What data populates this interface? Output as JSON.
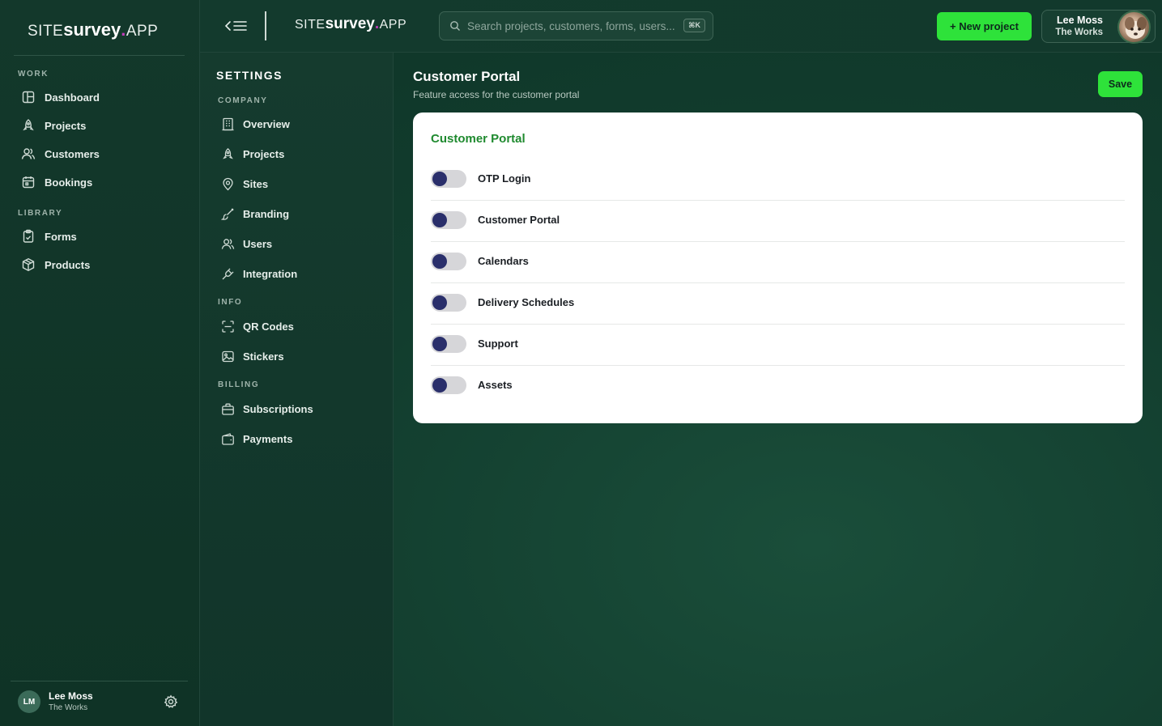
{
  "brand": {
    "prefix": "SITE",
    "mid": "survey",
    "dot": ".",
    "suffix": "APP"
  },
  "sidebar": {
    "sections": [
      {
        "label": "WORK"
      },
      {
        "label": "LIBRARY"
      }
    ],
    "items": [
      {
        "label": "Dashboard",
        "icon": "dashboard-icon"
      },
      {
        "label": "Projects",
        "icon": "rocket-icon"
      },
      {
        "label": "Customers",
        "icon": "users-icon"
      },
      {
        "label": "Bookings",
        "icon": "calendar-icon"
      },
      {
        "label": "Forms",
        "icon": "clipboard-icon"
      },
      {
        "label": "Products",
        "icon": "box-icon"
      }
    ],
    "user": {
      "initials": "LM",
      "name": "Lee Moss",
      "org": "The Works"
    }
  },
  "topbar": {
    "search": {
      "placeholder": "Search projects, customers, forms, users...",
      "shortcut": "⌘K"
    },
    "new_project_label": "+ New project",
    "user": {
      "name": "Lee Moss",
      "org": "The Works"
    }
  },
  "settings": {
    "title": "SETTINGS",
    "sections": [
      {
        "label": "COMPANY"
      },
      {
        "label": "INFO"
      },
      {
        "label": "BILLING"
      }
    ],
    "items": [
      {
        "label": "Overview",
        "icon": "building-icon"
      },
      {
        "label": "Projects",
        "icon": "rocket-icon"
      },
      {
        "label": "Sites",
        "icon": "map-pin-icon"
      },
      {
        "label": "Branding",
        "icon": "brush-icon"
      },
      {
        "label": "Users",
        "icon": "users-icon"
      },
      {
        "label": "Integration",
        "icon": "plug-icon"
      },
      {
        "label": "QR Codes",
        "icon": "scan-icon"
      },
      {
        "label": "Stickers",
        "icon": "image-icon"
      },
      {
        "label": "Subscriptions",
        "icon": "briefcase-icon"
      },
      {
        "label": "Payments",
        "icon": "wallet-icon"
      }
    ]
  },
  "main": {
    "title": "Customer Portal",
    "subtitle": "Feature access for the customer portal",
    "save_label": "Save",
    "card": {
      "title": "Customer Portal",
      "toggles": [
        {
          "label": "OTP Login",
          "enabled": false
        },
        {
          "label": "Customer Portal",
          "enabled": false
        },
        {
          "label": "Calendars",
          "enabled": false
        },
        {
          "label": "Delivery Schedules",
          "enabled": false
        },
        {
          "label": "Support",
          "enabled": false
        },
        {
          "label": "Assets",
          "enabled": false
        }
      ]
    }
  },
  "colors": {
    "accent_green": "#2ee23a",
    "card_title_green": "#1f8a2f",
    "toggle_knob": "#2a2f6b",
    "toggle_track": "#d6d6d9",
    "brand_dot": "#c03cb8"
  }
}
